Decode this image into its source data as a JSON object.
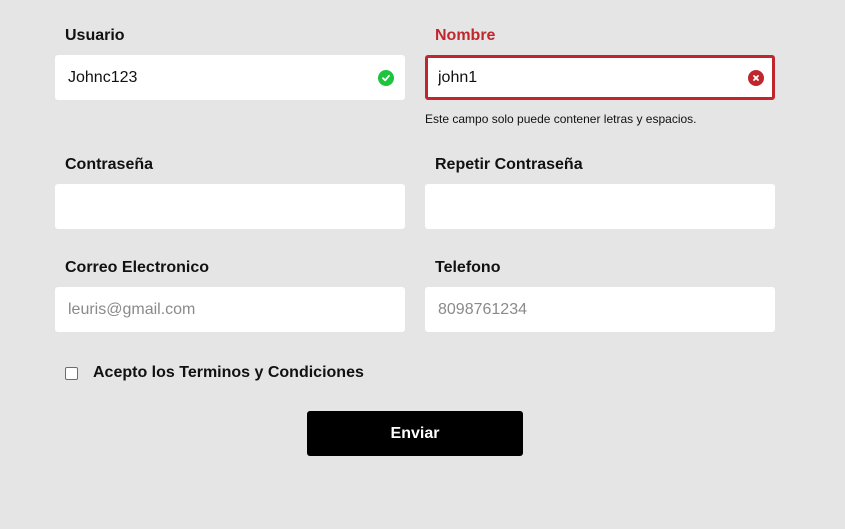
{
  "form": {
    "usuario": {
      "label": "Usuario",
      "value": "Johnc123",
      "status": "valid"
    },
    "nombre": {
      "label": "Nombre",
      "value": "john1",
      "status": "invalid",
      "error": "Este campo solo puede contener letras y espacios."
    },
    "contrasena": {
      "label": "Contraseña",
      "value": ""
    },
    "repetir_contrasena": {
      "label": "Repetir Contraseña",
      "value": ""
    },
    "correo": {
      "label": "Correo Electronico",
      "placeholder": "leuris@gmail.com",
      "value": ""
    },
    "telefono": {
      "label": "Telefono",
      "placeholder": "8098761234",
      "value": ""
    },
    "terms": {
      "label": "Acepto los Terminos y Condiciones",
      "checked": false
    },
    "submit_label": "Enviar"
  },
  "colors": {
    "background": "#e5e5e5",
    "error": "#c0272d",
    "success": "#1ec33e",
    "button": "#000000"
  },
  "icons": {
    "valid": "check-circle-icon",
    "invalid": "x-circle-icon"
  }
}
